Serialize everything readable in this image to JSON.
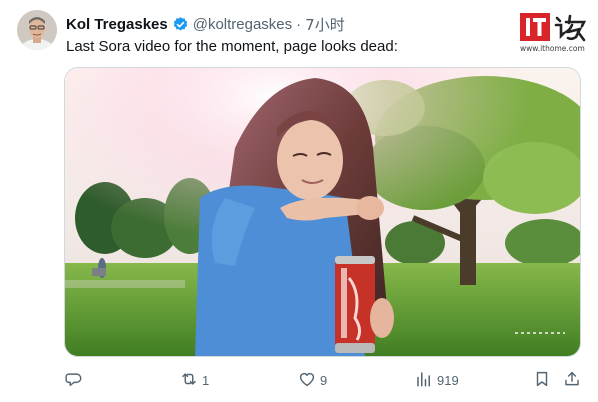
{
  "tweet": {
    "author_name": "Kol Tregaskes",
    "handle": "@koltregaskes",
    "separator": "·",
    "time": "7小时",
    "text": "Last Sora video for the moment, page looks dead:"
  },
  "watermark": {
    "logo_text": "IT之家",
    "url": "www.ithome.com"
  },
  "actions": {
    "replies": "",
    "retweets": "1",
    "likes": "9",
    "views": "919"
  },
  "colors": {
    "text": "#0f1419",
    "muted": "#536471",
    "verified": "#1d9bf0",
    "logo_red": "#d9242a"
  },
  "icons": [
    "reply-icon",
    "retweet-icon",
    "like-icon",
    "views-icon",
    "bookmark-icon",
    "share-icon",
    "verified-badge-icon"
  ]
}
